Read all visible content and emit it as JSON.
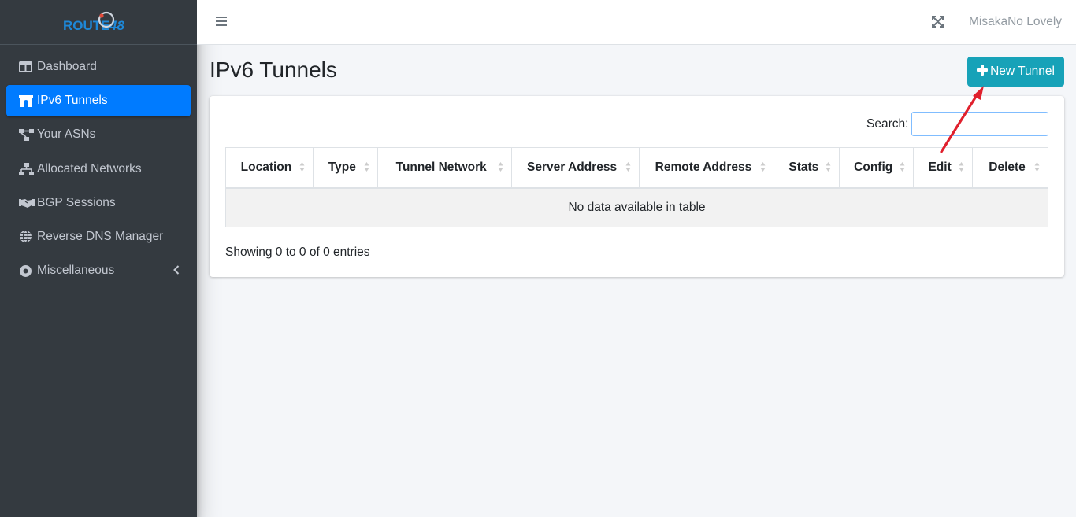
{
  "brand": {
    "logo_text": "ROUTE48"
  },
  "sidebar": {
    "items": [
      {
        "label": "Dashboard",
        "icon": "table-columns-icon"
      },
      {
        "label": "IPv6 Tunnels",
        "icon": "archway-icon",
        "active": true
      },
      {
        "label": "Your ASNs",
        "icon": "project-diagram-icon"
      },
      {
        "label": "Allocated Networks",
        "icon": "network-wired-icon"
      },
      {
        "label": "BGP Sessions",
        "icon": "handshake-icon"
      },
      {
        "label": "Reverse DNS Manager",
        "icon": "globe-icon"
      },
      {
        "label": "Miscellaneous",
        "icon": "dot-circle-icon",
        "has_submenu": true
      }
    ]
  },
  "topbar": {
    "username": "MisakaNo Lovely"
  },
  "page": {
    "title": "IPv6 Tunnels",
    "new_button_label": "New Tunnel"
  },
  "table": {
    "search_label": "Search:",
    "search_value": "",
    "columns": [
      "Location",
      "Type",
      "Tunnel Network",
      "Server Address",
      "Remote Address",
      "Stats",
      "Config",
      "Edit",
      "Delete"
    ],
    "empty_message": "No data available in table",
    "info": "Showing 0 to 0 of 0 entries"
  },
  "colors": {
    "sidebar_bg": "#343a40",
    "active_item": "#007bff",
    "button": "#17a2b8",
    "annotation_arrow": "#e0202d"
  }
}
